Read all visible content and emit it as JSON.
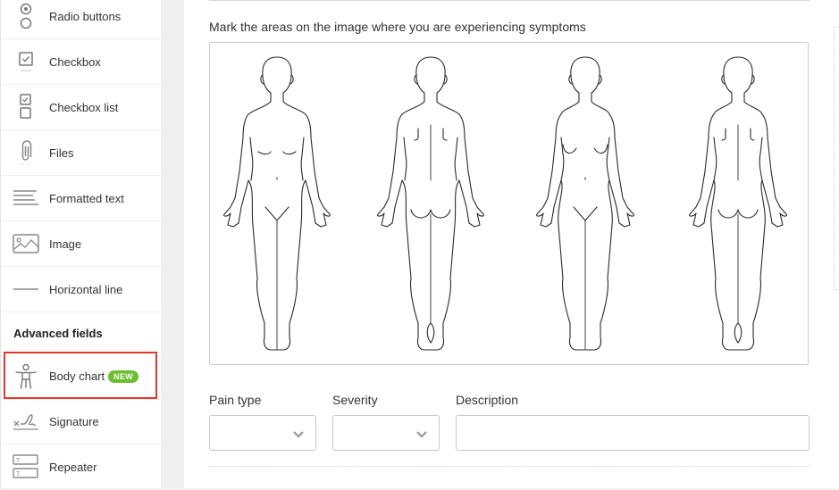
{
  "sidebar": {
    "items": [
      {
        "label": "Radio buttons",
        "icon": "radio-buttons-icon"
      },
      {
        "label": "Checkbox",
        "icon": "checkbox-icon"
      },
      {
        "label": "Checkbox list",
        "icon": "checkbox-list-icon"
      },
      {
        "label": "Files",
        "icon": "paperclip-icon"
      },
      {
        "label": "Formatted text",
        "icon": "formatted-text-icon"
      },
      {
        "label": "Image",
        "icon": "image-icon"
      },
      {
        "label": "Horizontal line",
        "icon": "horizontal-line-icon"
      }
    ],
    "advanced_heading": "Advanced fields",
    "advanced_items": [
      {
        "label": "Body chart",
        "icon": "body-icon",
        "badge": "NEW",
        "selected": true
      },
      {
        "label": "Signature",
        "icon": "signature-icon"
      },
      {
        "label": "Repeater",
        "icon": "repeater-icon"
      }
    ],
    "highlight_color": "#e6362a",
    "badge_color": "#6cbd2f"
  },
  "main": {
    "prompt": "Mark the areas on the image where you are experiencing symptoms",
    "figures": [
      {
        "view": "front",
        "sex": "male"
      },
      {
        "view": "back",
        "sex": "male"
      },
      {
        "view": "front",
        "sex": "female"
      },
      {
        "view": "back",
        "sex": "female"
      }
    ],
    "fields": {
      "pain_type": {
        "label": "Pain type",
        "value": ""
      },
      "severity": {
        "label": "Severity",
        "value": ""
      },
      "description": {
        "label": "Description",
        "value": ""
      }
    }
  }
}
